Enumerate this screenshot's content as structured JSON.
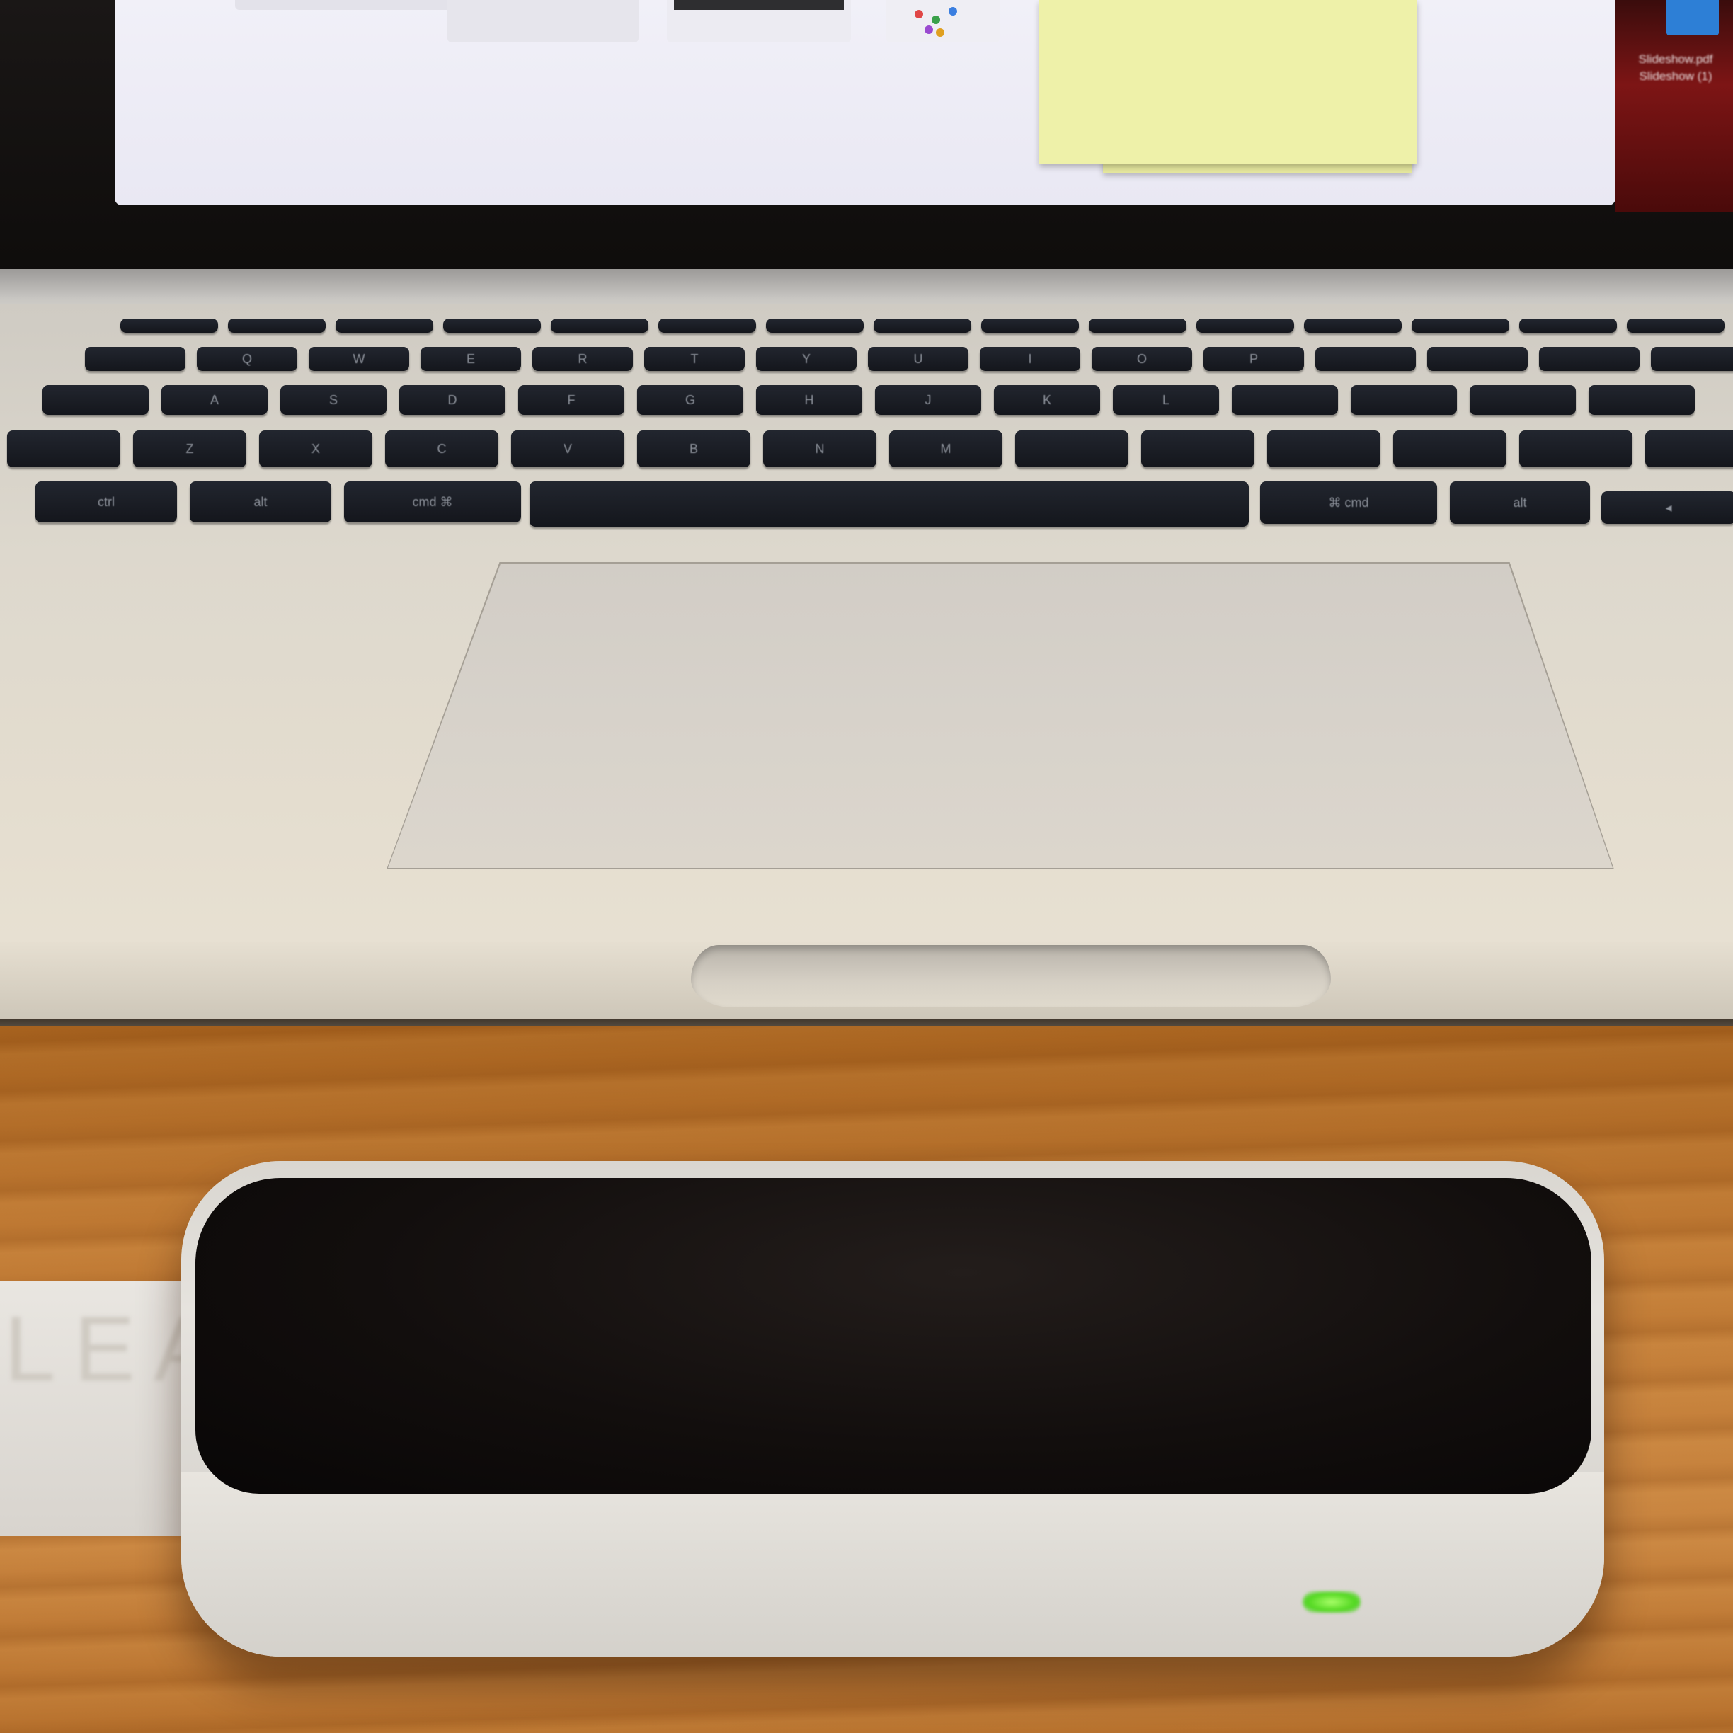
{
  "scene": {
    "subject": "laptop-and-hand-tracking-controller"
  },
  "display": {
    "desktop_icon_label": "Slideshow.pdf",
    "desktop_icon_label_2": "Slideshow (1)"
  },
  "keyboard": {
    "row1": [
      "Q",
      "W",
      "E",
      "R",
      "T",
      "Y",
      "U",
      "I",
      "O",
      "P"
    ],
    "row2": [
      "A",
      "S",
      "D",
      "F",
      "G",
      "H",
      "J",
      "K",
      "L"
    ],
    "row3": [
      "Z",
      "X",
      "C",
      "V",
      "B",
      "N",
      "M"
    ],
    "bottom": {
      "ctrl": "ctrl",
      "alt_left": "alt",
      "cmd_left": "cmd",
      "cmd_left_symbol": "⌘",
      "cmd_right_symbol": "⌘",
      "cmd_right": "cmd",
      "alt_right": "alt"
    }
  },
  "device": {
    "cable_print": "LEAP",
    "led_color": "#5ee02a"
  },
  "colors": {
    "desk": "#c07a34",
    "aluminum": "#ddd8cd",
    "key": "#1a1d24",
    "note": "#eef1a9"
  }
}
